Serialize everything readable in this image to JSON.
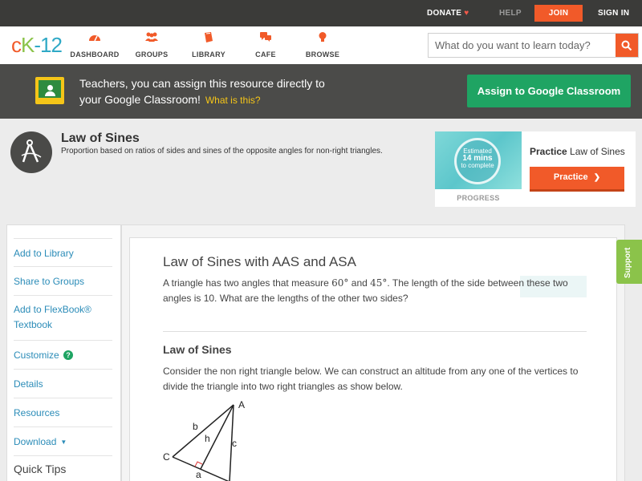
{
  "topbar": {
    "donate": "DONATE",
    "help": "HELP",
    "join": "JOIN",
    "signin": "SIGN IN"
  },
  "logo": {
    "c": "c",
    "k": "K",
    "n": "-12"
  },
  "nav": {
    "dashboard": "DASHBOARD",
    "groups": "GROUPS",
    "library": "LIBRARY",
    "cafe": "CAFE",
    "browse": "BROWSE"
  },
  "search": {
    "placeholder": "What do you want to learn today?"
  },
  "banner": {
    "line1": "Teachers, you can assign this resource directly to",
    "line2": "your Google Classroom!",
    "what": "What is this?",
    "assign": "Assign to Google Classroom"
  },
  "concept": {
    "title": "Law of Sines",
    "description": "Proportion based on ratios of sides and sines of the opposite angles for non-right triangles."
  },
  "practice": {
    "estimated": "Estimated",
    "mins": "14 mins",
    "to_complete": "to complete",
    "progress": "PROGRESS",
    "title_bold": "Practice",
    "title_rest": "Law of Sines",
    "button": "Practice"
  },
  "sidebar": {
    "items": [
      {
        "label": "Add to Library"
      },
      {
        "label": "Share to Groups"
      },
      {
        "label": "Add to FlexBook® Textbook"
      },
      {
        "label": "Customize"
      },
      {
        "label": "Details"
      },
      {
        "label": "Resources"
      },
      {
        "label": "Download"
      }
    ],
    "quick_tips": "Quick Tips"
  },
  "content": {
    "title": "Law of Sines with AAS and ASA",
    "problem_a": "A triangle has two angles that measure",
    "angle1": "60°",
    "and": "and",
    "angle2": "45°",
    "problem_b": ". The length of the side between these two angles is 10. What are the lengths of the other two sides?",
    "heading": "Law of Sines",
    "paragraph": "Consider the non right triangle below. We can construct an altitude from any one of the vertices to divide the triangle into two right triangles as show below.",
    "triangle_labels": {
      "A": "A",
      "b": "b",
      "h": "h",
      "c": "c",
      "C": "C",
      "a": "a"
    }
  },
  "support": "Support",
  "colors": {
    "accent": "#f15a29",
    "green": "#1fa463",
    "link": "#2b8cb8",
    "dark_bar": "#3b3b39"
  }
}
